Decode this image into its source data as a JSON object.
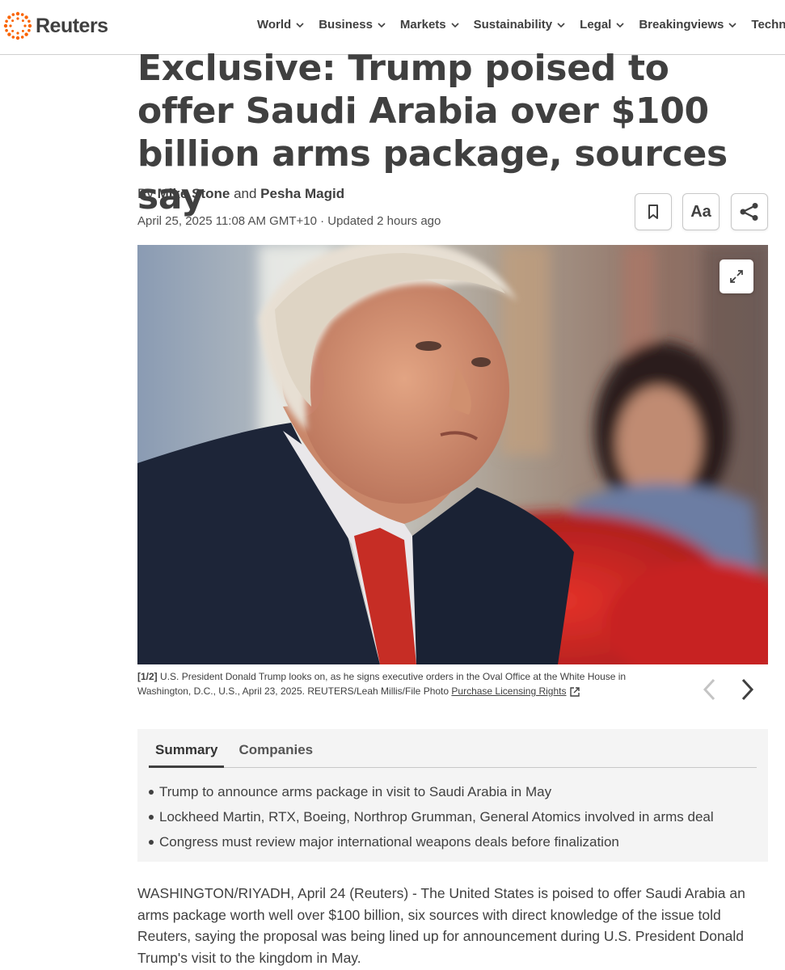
{
  "header": {
    "logo_text": "Reuters",
    "nav": [
      {
        "label": "World"
      },
      {
        "label": "Business"
      },
      {
        "label": "Markets"
      },
      {
        "label": "Sustainability"
      },
      {
        "label": "Legal"
      },
      {
        "label": "Breakingviews"
      },
      {
        "label": "Technology"
      }
    ]
  },
  "article": {
    "headline": "Exclusive: Trump poised to offer Saudi Arabia over $100 billion arms package, sources say",
    "byline_prefix": "By",
    "author1": "Mike Stone",
    "byline_and": "and",
    "author2": "Pesha Magid",
    "dateline": "April 25, 2025 11:08 AM GMT+10 · Updated 2 hours ago",
    "tools": {
      "font_label": "Aa"
    },
    "photo": {
      "index": "[1/2]",
      "caption": "U.S. President Donald Trump looks on, as he signs executive orders in the Oval Office at the White House in Washington, D.C., U.S., April 23, 2025. REUTERS/Leah Millis/File Photo",
      "license_link": "Purchase Licensing Rights"
    },
    "summary": {
      "tabs": [
        "Summary",
        "Companies"
      ],
      "bullets": [
        "Trump to announce arms package in visit to Saudi Arabia in May",
        "Lockheed Martin, RTX, Boeing, Northrop Grumman, General Atomics involved in arms deal",
        "Congress must review major international weapons deals before finalization"
      ]
    },
    "body": "WASHINGTON/RIYADH, April 24 (Reuters) - The United States is poised to offer Saudi Arabia an arms package worth well over $100 billion, six sources with direct knowledge of the issue told Reuters, saying the proposal was being lined up for announcement during U.S. President Donald Trump's visit to the kingdom in May."
  },
  "colors": {
    "logo_orange": "#fa6400",
    "text": "#404040",
    "summary_bg": "#f4f4f4"
  }
}
